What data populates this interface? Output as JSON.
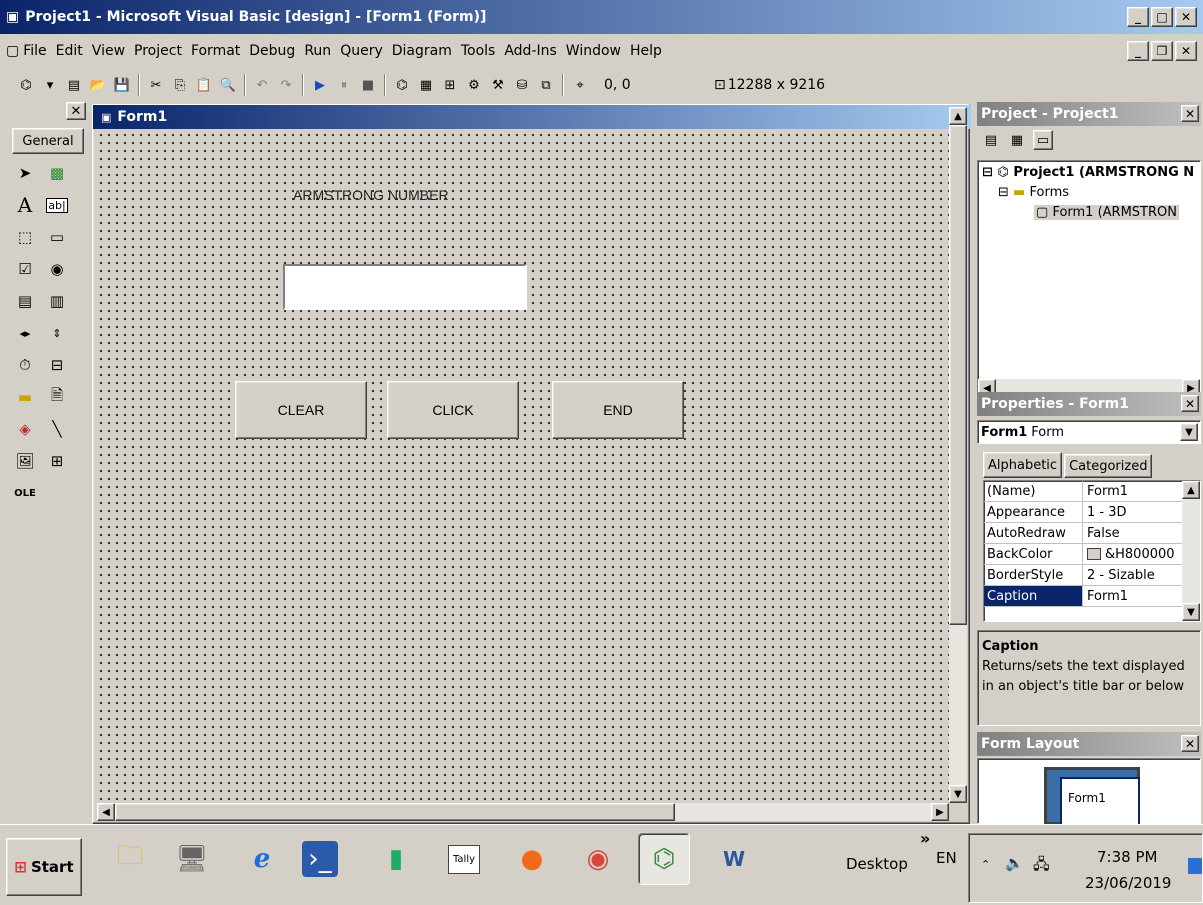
{
  "window": {
    "title": "Project1 - Microsoft Visual Basic [design] - [Form1 (Form)]"
  },
  "menu": {
    "items": [
      "File",
      "Edit",
      "View",
      "Project",
      "Format",
      "Debug",
      "Run",
      "Query",
      "Diagram",
      "Tools",
      "Add-Ins",
      "Window",
      "Help"
    ]
  },
  "toolbar": {
    "position": "0, 0",
    "size": "12288 x 9216"
  },
  "toolbox": {
    "tab": "General"
  },
  "form": {
    "title": "Form1",
    "label": "ARMSTRONG NUMBER",
    "textbox_value": "",
    "buttons": [
      "CLEAR",
      "CLICK",
      "END"
    ]
  },
  "project": {
    "title": "Project - Project1",
    "root": "Project1 (ARMSTRONG N",
    "folder": "Forms",
    "item": "Form1 (ARMSTRON"
  },
  "properties": {
    "title": "Properties - Form1",
    "object_name": "Form1",
    "object_type": "Form",
    "tabs": [
      "Alphabetic",
      "Categorized"
    ],
    "rows": [
      {
        "name": "(Name)",
        "value": "Form1"
      },
      {
        "name": "Appearance",
        "value": "1 - 3D"
      },
      {
        "name": "AutoRedraw",
        "value": "False"
      },
      {
        "name": "BackColor",
        "value": "&H800000"
      },
      {
        "name": "BorderStyle",
        "value": "2 - Sizable"
      },
      {
        "name": "Caption",
        "value": "Form1"
      }
    ],
    "desc_title": "Caption",
    "desc_text": "Returns/sets the text displayed in an object's title bar or below"
  },
  "layout": {
    "title": "Form Layout",
    "form_label": "Form1"
  },
  "taskbar": {
    "start": "Start",
    "desktop": "Desktop",
    "lang": "EN",
    "time": "7:38 PM",
    "date": "23/06/2019",
    "chevron": "»"
  },
  "colors": {
    "title_active": "#0a246a",
    "title_gradient": "#a6caf0",
    "face": "#d4d0c8"
  }
}
